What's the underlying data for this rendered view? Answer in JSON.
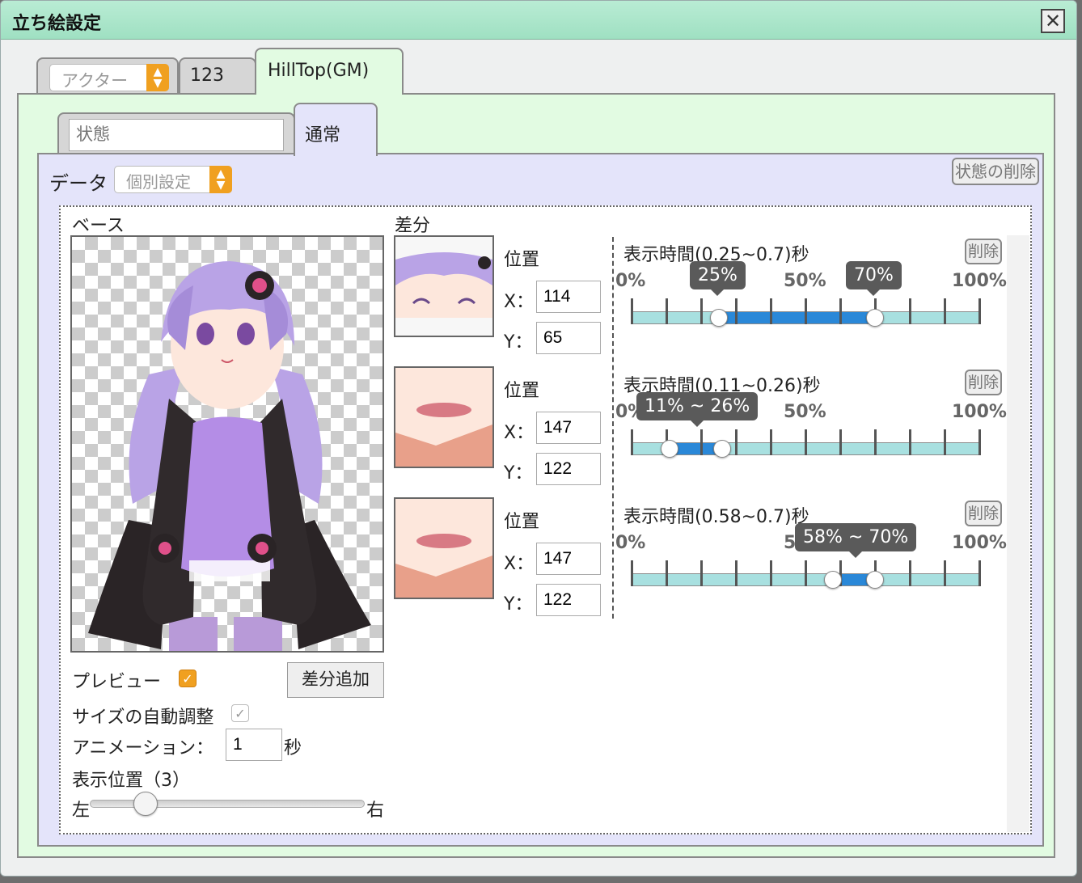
{
  "window": {
    "title": "立ち絵設定",
    "close_glyph": "✕"
  },
  "outer_tabs": {
    "actor_select": "アクター",
    "tab2": "123",
    "tab3": "HillTop(GM)"
  },
  "inner_tabs": {
    "state_placeholder": "状態",
    "active_tab": "通常"
  },
  "data_row": {
    "label": "データ",
    "select_value": "個別設定",
    "delete_state": "状態の削除"
  },
  "base": {
    "label": "ベース",
    "preview_label": "プレビュー",
    "add_diff_button": "差分追加",
    "auto_size_label": "サイズの自動調整",
    "animation_label": "アニメーション：",
    "animation_value": "1",
    "animation_unit": "秒",
    "position_label": "表示位置（3）",
    "left_label": "左",
    "right_label": "右",
    "position_value": 0.2
  },
  "diff": {
    "label": "差分",
    "position_label": "位置",
    "x_label": "X：",
    "y_label": "Y：",
    "delete_label": "削除",
    "tick_0": "0%",
    "tick_50": "50%",
    "tick_100": "100%",
    "items": [
      {
        "x": "114",
        "y": "65",
        "time_label": "表示時間(0.25~0.7)秒",
        "start": 25,
        "end": 70,
        "tooltip_start": "25%",
        "tooltip_end": "70%"
      },
      {
        "x": "147",
        "y": "122",
        "time_label": "表示時間(0.11~0.26)秒",
        "start": 11,
        "end": 26,
        "tooltip": "11% ~ 26%"
      },
      {
        "x": "147",
        "y": "122",
        "time_label": "表示時間(0.58~0.7)秒",
        "start": 58,
        "end": 70,
        "tooltip": "58% ~ 70%"
      }
    ]
  },
  "colors": {
    "accent_orange": "#f0a020",
    "range_fill": "#2a88d8",
    "range_track": "#a8e0e0",
    "titlebar": "#9fe0c2"
  }
}
